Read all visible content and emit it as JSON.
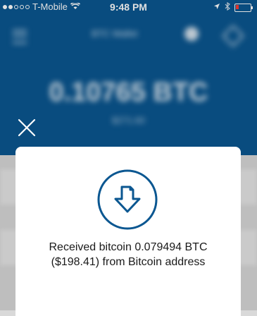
{
  "status_bar": {
    "carrier": "T-Mobile",
    "time": "9:48 PM"
  },
  "background": {
    "nav_title": "BTC Wallet",
    "balance": "0.10765 BTC",
    "balance_fiat": "$271.60"
  },
  "modal": {
    "message": "Received bitcoin 0.079494 BTC ($198.41) from Bitcoin address"
  },
  "colors": {
    "header_blue": "#0b5791",
    "icon_blue": "#0b5791"
  }
}
